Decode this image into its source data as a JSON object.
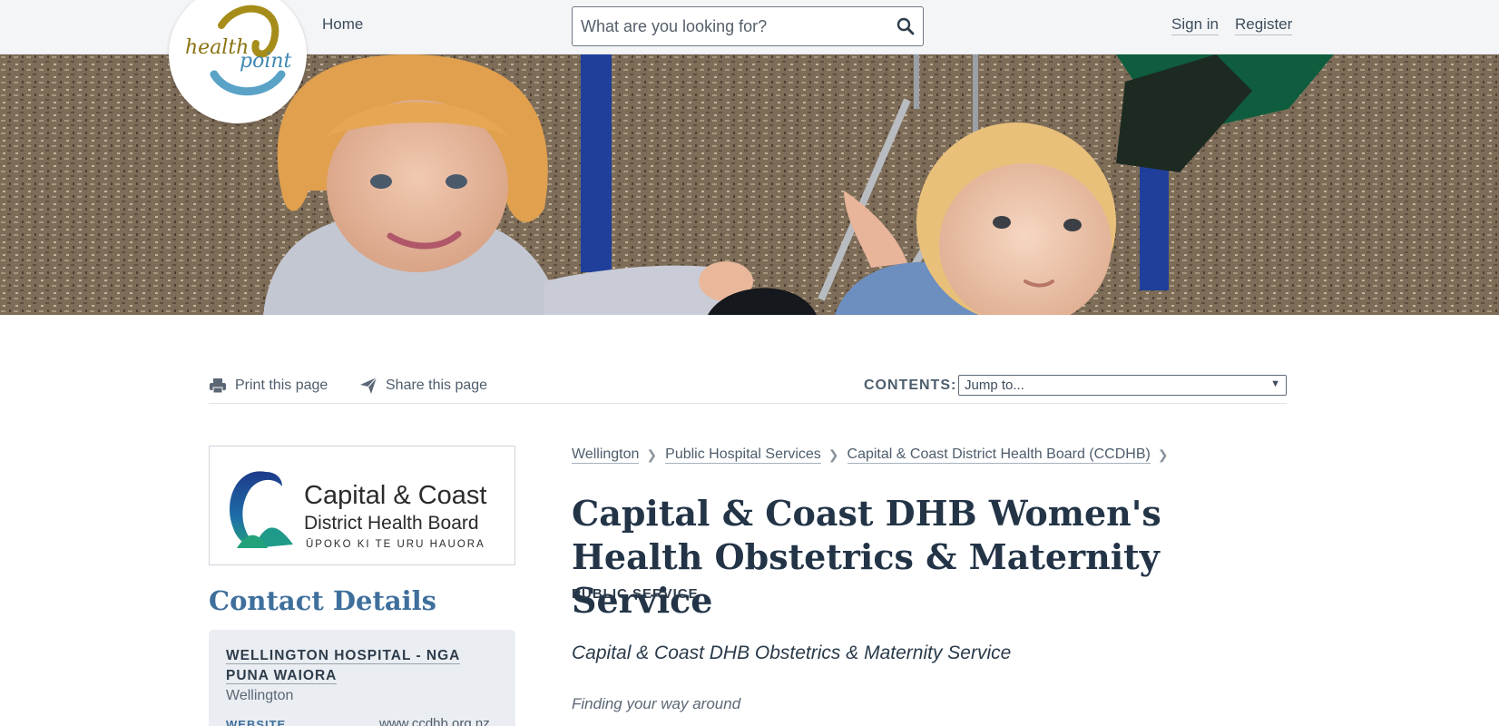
{
  "header": {
    "logo_text_1": "health",
    "logo_text_2": "point",
    "nav_home": "Home",
    "search_placeholder": "What are you looking for?",
    "sign_in": "Sign in",
    "register": "Register"
  },
  "toolbar": {
    "print": "Print this page",
    "share": "Share this page",
    "contents_label": "CONTENTS:",
    "jump_selected": "Jump to..."
  },
  "org_logo": {
    "line1": "Capital & Coast",
    "line2": "District Health Board",
    "line3": "ŪPOKO KI TE URU HAUORA"
  },
  "contact": {
    "title": "Contact Details",
    "location_name": "WELLINGTON HOSPITAL - NGA PUNA WAIORA",
    "city": "Wellington",
    "website_label": "WEBSITE",
    "website_value": "www.ccdhb.org.nz"
  },
  "breadcrumb": [
    "Wellington",
    "Public Hospital Services",
    "Capital & Coast District Health Board (CCDHB)"
  ],
  "main": {
    "title": "Capital & Coast DHB Women's Health Obstetrics & Maternity Service",
    "service_type": "PUBLIC SERVICE",
    "subtitle": "Capital & Coast DHB Obstetrics & Maternity Service",
    "section_heading": "Finding your way around"
  },
  "colors": {
    "accent_blue": "#3f6f9c",
    "title_navy": "#233447",
    "logo_gold": "#a68d1a",
    "logo_teal": "#5aa3c7"
  }
}
